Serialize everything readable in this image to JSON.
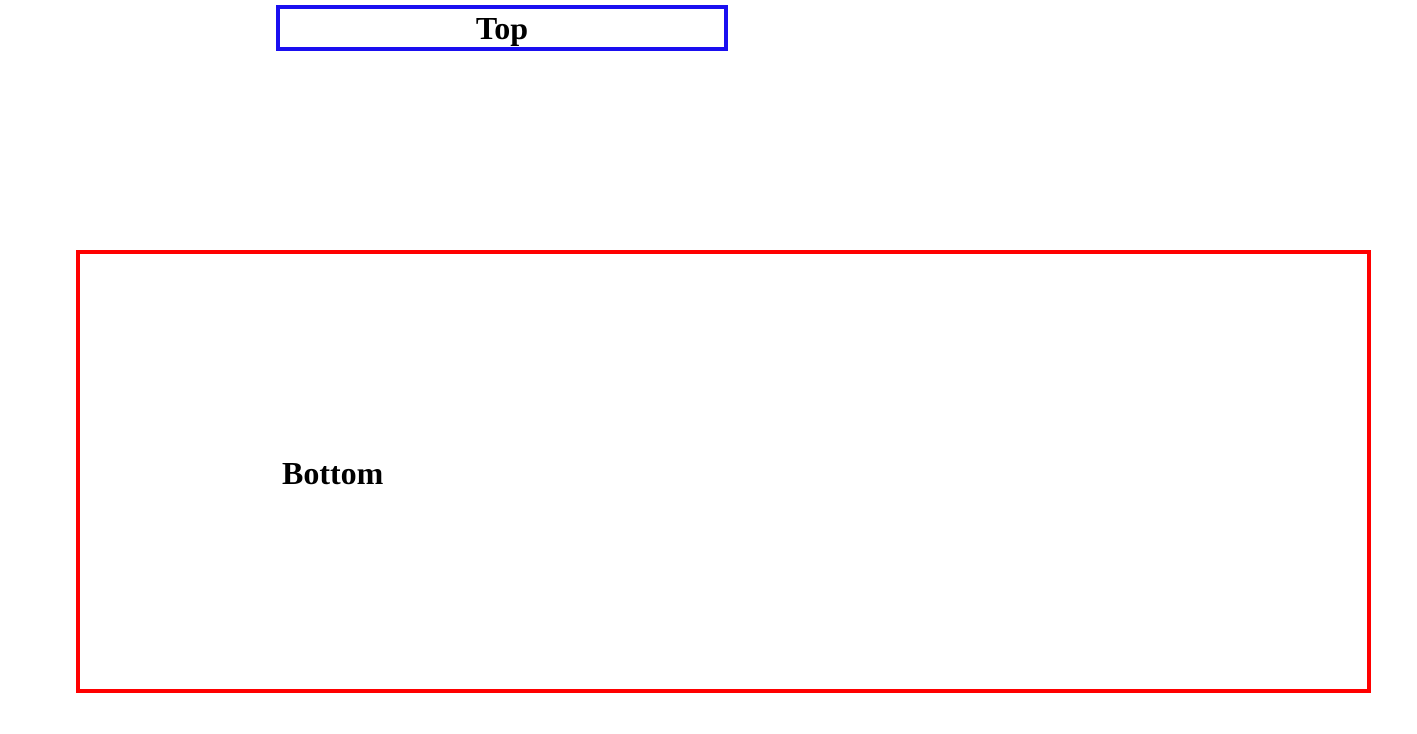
{
  "top_box": {
    "label": "Top",
    "border_color": "#1a0ff0"
  },
  "bottom_box": {
    "label": "Bottom",
    "border_color": "#ff0000"
  }
}
